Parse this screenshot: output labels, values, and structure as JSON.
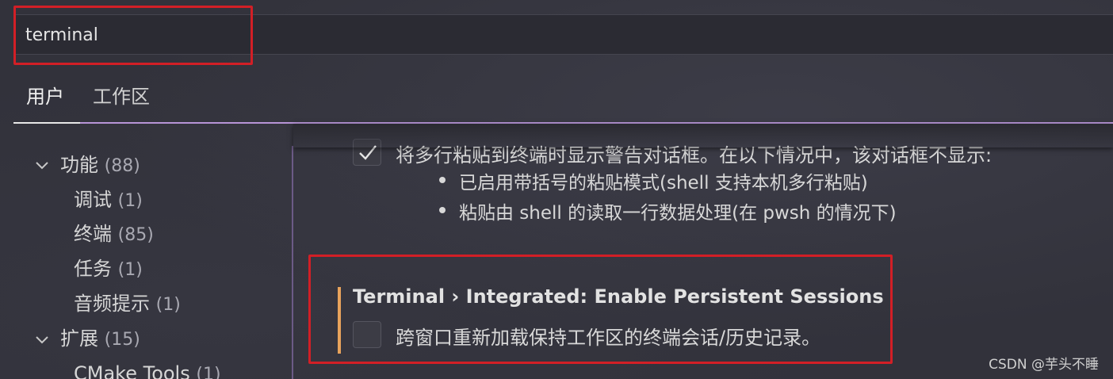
{
  "search": {
    "value": "terminal"
  },
  "tabs": [
    {
      "label": "用户",
      "active": true
    },
    {
      "label": "工作区",
      "active": false
    }
  ],
  "tree": {
    "features": {
      "label": "功能",
      "count": "(88)"
    },
    "debug": {
      "label": "调试",
      "count": "(1)"
    },
    "terminal": {
      "label": "终端",
      "count": "(85)"
    },
    "tasks": {
      "label": "任务",
      "count": "(1)"
    },
    "audio_cues": {
      "label": "音频提示",
      "count": "(1)"
    },
    "extensions": {
      "label": "扩展",
      "count": "(15)"
    },
    "cmake_tools": {
      "label": "CMake Tools",
      "count": "(1)"
    }
  },
  "settings": {
    "paste_warning": {
      "checked": true,
      "description": "将多行粘贴到终端时显示警告对话框。在以下情况中，该对话框不显示:",
      "bullets": [
        "已启用带括号的粘贴模式(shell 支持本机多行粘贴)",
        "粘贴由 shell 的读取一行数据处理(在 pwsh 的情况下)"
      ]
    },
    "persistent_sessions": {
      "title_category": "Terminal › Integrated: ",
      "title_name": "Enable Persistent Sessions",
      "checked": false,
      "description": "跨窗口重新加载保持工作区的终端会话/历史记录。"
    }
  },
  "watermark": "CSDN @芋头不睡",
  "colors": {
    "highlight_box": "#d21f26",
    "modified_indicator": "#e8a35c",
    "tab_underline": "#b794d6"
  }
}
